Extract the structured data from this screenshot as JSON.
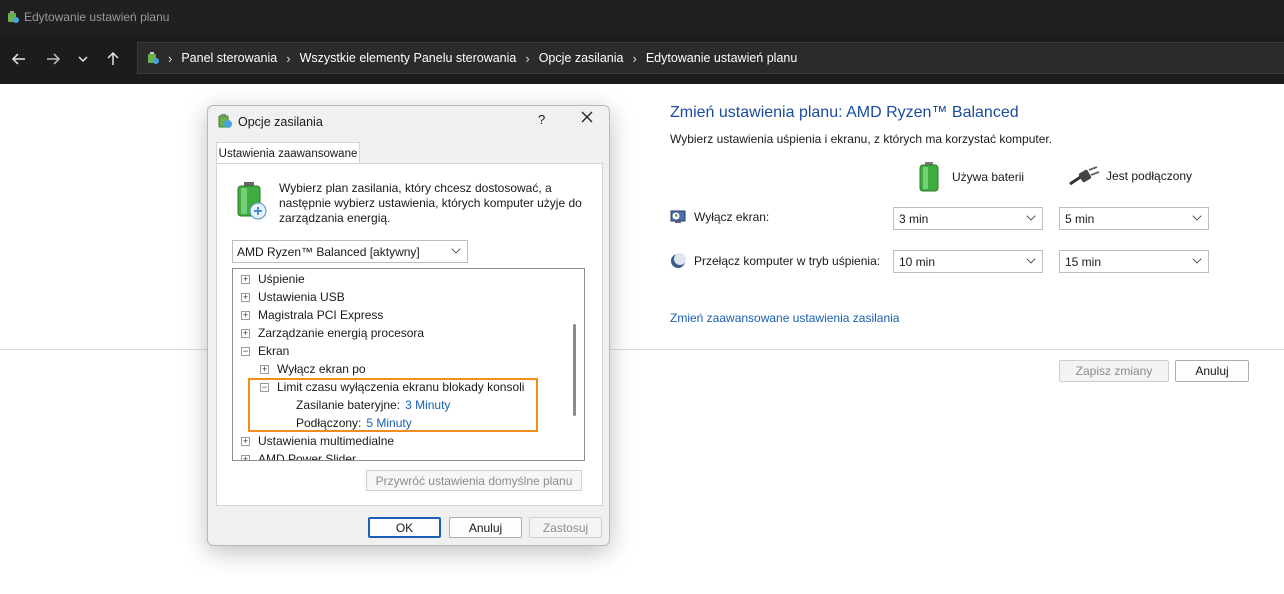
{
  "window": {
    "title": "Edytowanie ustawień planu"
  },
  "nav": {
    "breadcrumbs": [
      "Panel sterowania",
      "Wszystkie elementy Panelu sterowania",
      "Opcje zasilania",
      "Edytowanie ustawień planu"
    ]
  },
  "plan": {
    "title": "Zmień ustawienia planu: AMD Ryzen™ Balanced",
    "subtitle": "Wybierz ustawienia uśpienia i ekranu, z których ma korzystać komputer.",
    "col_battery": "Używa baterii",
    "col_plugged": "Jest podłączony",
    "rows": [
      {
        "label": "Wyłącz ekran:",
        "battery": "3 min",
        "plugged": "5 min"
      },
      {
        "label": "Przełącz komputer w tryb uśpienia:",
        "battery": "10 min",
        "plugged": "15 min"
      }
    ],
    "advanced_link": "Zmień zaawansowane ustawienia zasilania",
    "save_label": "Zapisz zmiany",
    "cancel_label": "Anuluj"
  },
  "dialog": {
    "title": "Opcje zasilania",
    "help": "?",
    "tab": "Ustawienia zaawansowane",
    "intro": "Wybierz plan zasilania, który chcesz dostosować, a następnie wybierz ustawienia, których komputer użyje do zarządzania energią.",
    "plan_selected": "AMD Ryzen™ Balanced [aktywny]",
    "tree": {
      "sleep": "Uśpienie",
      "usb": "Ustawienia USB",
      "pci": "Magistrala PCI Express",
      "cpu": "Zarządzanie energią procesora",
      "display": "Ekran",
      "display_off": "Wyłącz ekran po",
      "console_lock": "Limit czasu wyłączenia ekranu blokady konsoli",
      "battery_label": "Zasilanie bateryjne:",
      "battery_value": "3 Minuty",
      "plugged_label": "Podłączony:",
      "plugged_value": "5 Minuty",
      "multimedia": "Ustawienia multimedialne",
      "amd_slider": "AMD Power Slider"
    },
    "restore_label": "Przywróć ustawienia domyślne planu",
    "ok_label": "OK",
    "cancel_label": "Anuluj",
    "apply_label": "Zastosuj"
  },
  "colors": {
    "accent": "#1a5fb4",
    "highlight": "#f28c1c",
    "dark_bg": "#202020"
  }
}
